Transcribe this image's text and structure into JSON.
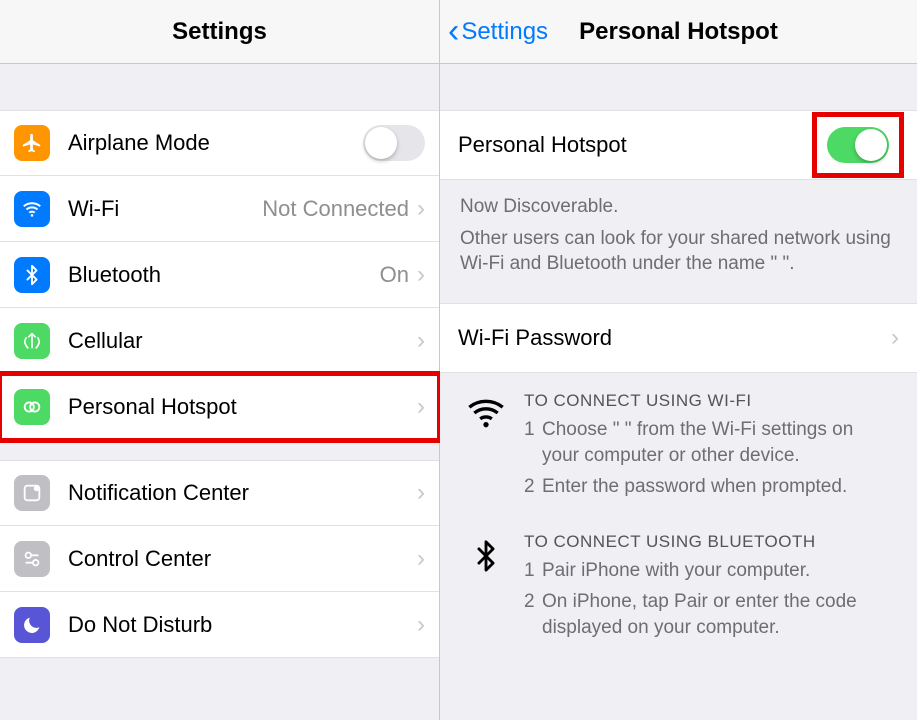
{
  "left": {
    "title": "Settings",
    "airplane": {
      "label": "Airplane Mode",
      "on": false
    },
    "wifi": {
      "label": "Wi-Fi",
      "value": "Not Connected"
    },
    "bluetooth": {
      "label": "Bluetooth",
      "value": "On"
    },
    "cellular": {
      "label": "Cellular"
    },
    "hotspot": {
      "label": "Personal Hotspot"
    },
    "notif": {
      "label": "Notification Center"
    },
    "control": {
      "label": "Control Center"
    },
    "dnd": {
      "label": "Do Not Disturb"
    }
  },
  "right": {
    "back": "Settings",
    "title": "Personal Hotspot",
    "toggle": {
      "label": "Personal Hotspot",
      "on": true
    },
    "note1": "Now Discoverable.",
    "note2": "Other users can look for your shared network using Wi-Fi and Bluetooth under the name \"                         \".",
    "wifipw": {
      "label": "Wi-Fi Password"
    },
    "wifi_instr": {
      "head": "TO CONNECT USING WI-FI",
      "s1": "Choose \"                           \" from the Wi-Fi settings on your computer or other device.",
      "s2": "Enter the password when prompted."
    },
    "bt_instr": {
      "head": "TO CONNECT USING BLUETOOTH",
      "s1": "Pair iPhone with your computer.",
      "s2": "On iPhone, tap Pair or enter the code displayed on your computer."
    }
  }
}
